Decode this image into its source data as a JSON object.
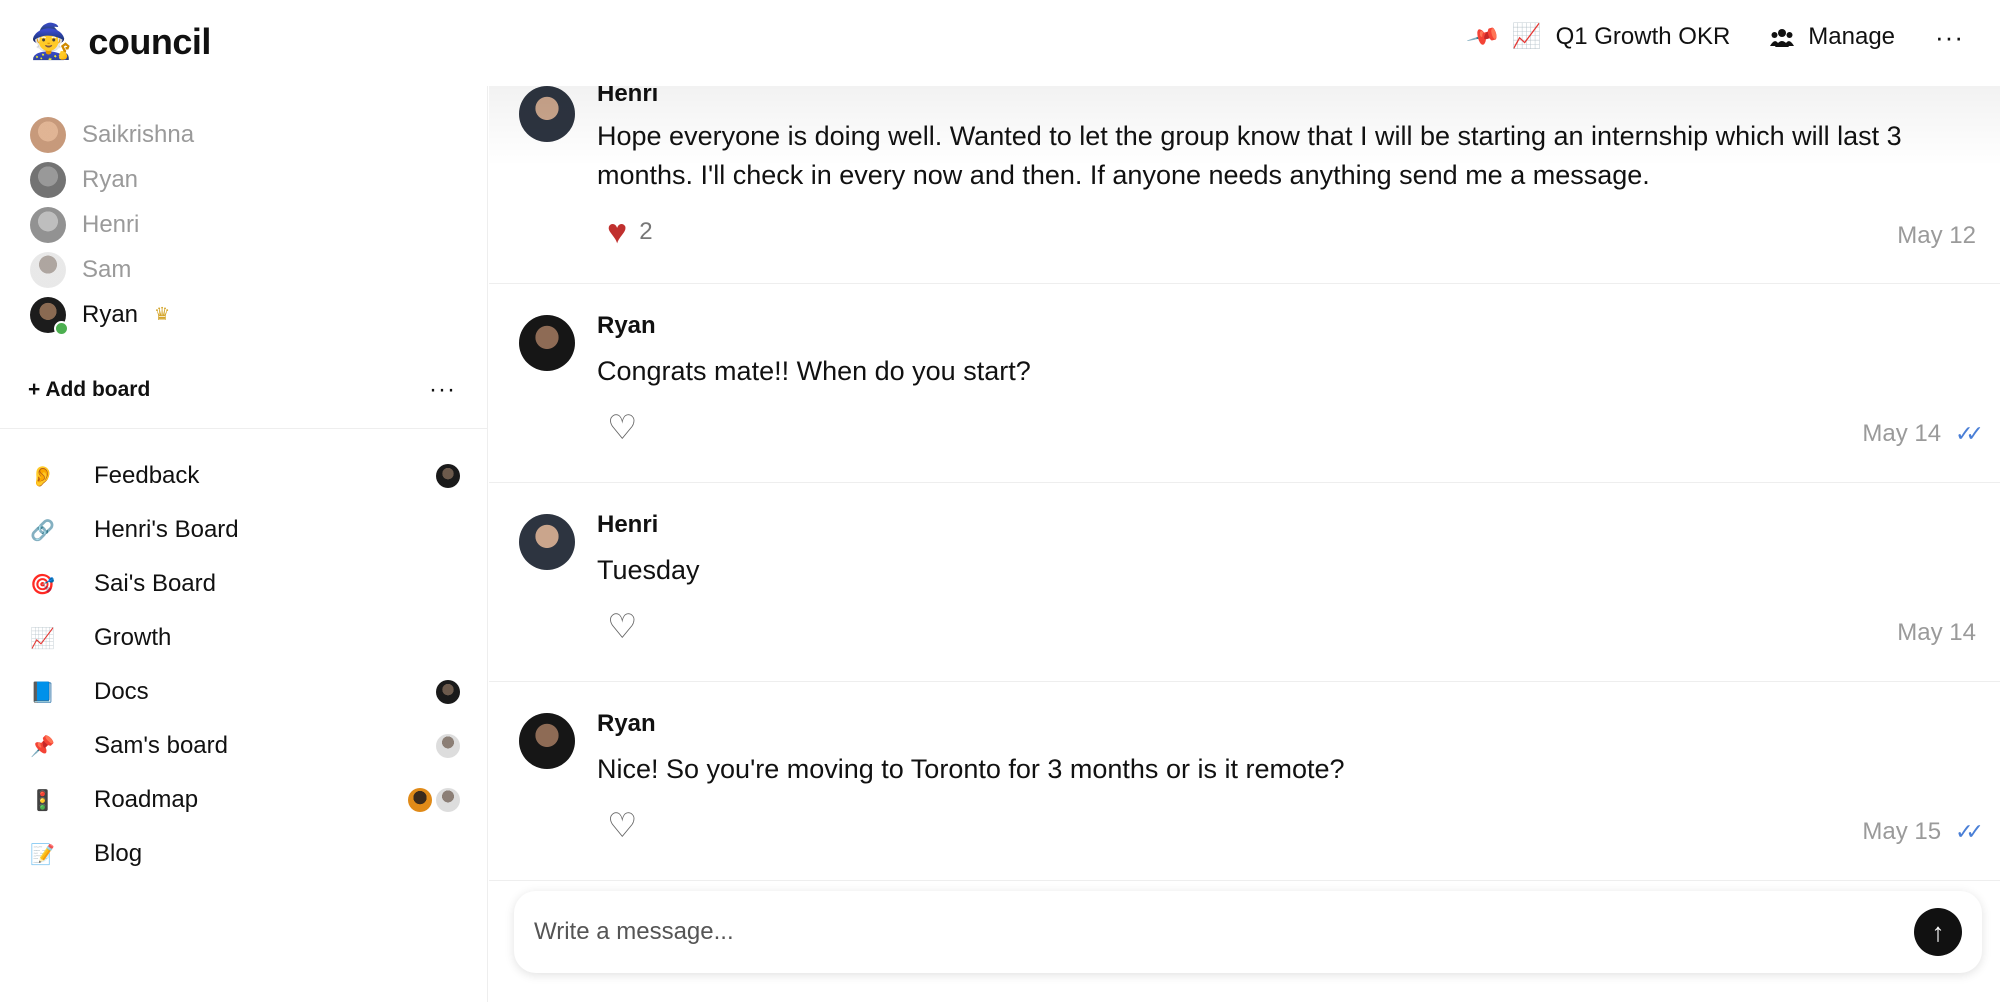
{
  "app": {
    "logo_emoji": "🧙",
    "name": "council"
  },
  "header": {
    "pinned_board": {
      "emoji": "📈",
      "label": "Q1 Growth OKR"
    },
    "manage_label": "Manage",
    "more_label": "···"
  },
  "members": [
    {
      "name": "Saikrishna",
      "active": false
    },
    {
      "name": "Ryan",
      "active": false
    },
    {
      "name": "Henri",
      "active": false
    },
    {
      "name": "Sam",
      "active": false
    },
    {
      "name": "Ryan",
      "active": true,
      "online": true,
      "badge": "crown-icon"
    }
  ],
  "add_board_label": "+ Add board",
  "add_board_more": "···",
  "boards": [
    {
      "icon": "👂",
      "icon_name": "ear-icon",
      "label": "Feedback"
    },
    {
      "icon": "🔗",
      "icon_name": "link-icon",
      "label": "Henri's Board"
    },
    {
      "icon": "🎯",
      "icon_name": "target-icon",
      "label": "Sai's Board"
    },
    {
      "icon": "📈",
      "icon_name": "chart-up-icon",
      "label": "Growth"
    },
    {
      "icon": "📘",
      "icon_name": "book-icon",
      "label": "Docs"
    },
    {
      "icon": "📌",
      "icon_name": "pushpin-icon",
      "label": "Sam's board"
    },
    {
      "icon": "🚦",
      "icon_name": "traffic-light-icon",
      "label": "Roadmap"
    },
    {
      "icon": "📝",
      "icon_name": "memo-icon",
      "label": "Blog"
    }
  ],
  "messages": [
    {
      "author": "Henri",
      "text": "Hope everyone is doing well. Wanted to let the group know that I will be starting an internship which will last 3 months. I'll check in every now and then. If anyone needs anything send me a message.",
      "likes": "2",
      "liked": true,
      "date": "May 12",
      "read": false
    },
    {
      "author": "Ryan",
      "text": "Congrats mate!! When do you start?",
      "likes": "",
      "liked": false,
      "date": "May 14",
      "read": true
    },
    {
      "author": "Henri",
      "text": "Tuesday",
      "likes": "",
      "liked": false,
      "date": "May 14",
      "read": false
    },
    {
      "author": "Ryan",
      "text": "Nice! So you're moving to Toronto for 3 months or is it remote?",
      "likes": "",
      "liked": false,
      "date": "May 15",
      "read": true
    }
  ],
  "composer": {
    "placeholder": "Write a message...",
    "send_icon": "↑"
  },
  "colors": {
    "like_red": "#c0302e",
    "read_blue": "#4a7fd6",
    "crown_gold": "#d4a52a",
    "online_green": "#4caf50"
  }
}
